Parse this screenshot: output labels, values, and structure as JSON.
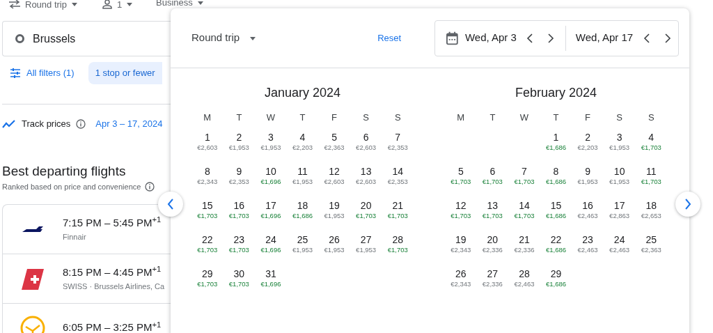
{
  "top_bar": {
    "trip_type": "Round trip",
    "passengers": "1",
    "cabin": "Business"
  },
  "origin": "Brussels",
  "filters": {
    "all_filters": "All filters (1)",
    "chip": "1 stop or fewer"
  },
  "track": {
    "label": "Track prices",
    "dates": "Apr 3 – 17, 2024"
  },
  "results": {
    "title": "Best departing flights",
    "subtitle": "Ranked based on price and convenience",
    "flights": [
      {
        "kind": "finnair",
        "times": "7:15 PM – 5:45 PM",
        "next_day": "+1",
        "airline": "Finnair"
      },
      {
        "kind": "swiss",
        "times": "8:15 PM – 4:45 PM",
        "next_day": "+1",
        "airline": "SWISS · Brussels Airlines, Ca"
      },
      {
        "kind": "lufthansa",
        "times": "6:05 PM – 3:25 PM",
        "next_day": "+1"
      }
    ]
  },
  "popup": {
    "trip_type": "Round trip",
    "reset": "Reset",
    "departure": "Wed, Apr 3",
    "return": "Wed, Apr 17",
    "months": [
      {
        "title": "January 2024",
        "weekdays": [
          "M",
          "T",
          "W",
          "T",
          "F",
          "S",
          "S"
        ],
        "weeks": [
          [
            {
              "day": "1",
              "price": "€2,603",
              "low": false
            },
            {
              "day": "2",
              "price": "€1,953",
              "low": false
            },
            {
              "day": "3",
              "price": "€1,953",
              "low": false
            },
            {
              "day": "4",
              "price": "€2,203",
              "low": false
            },
            {
              "day": "5",
              "price": "€2,363",
              "low": false
            },
            {
              "day": "6",
              "price": "€2,603",
              "low": false
            },
            {
              "day": "7",
              "price": "€2,353",
              "low": false
            }
          ],
          [
            {
              "day": "8",
              "price": "€2,343",
              "low": false
            },
            {
              "day": "9",
              "price": "€2,353",
              "low": false
            },
            {
              "day": "10",
              "price": "€1,696",
              "low": true
            },
            {
              "day": "11",
              "price": "€1,953",
              "low": false
            },
            {
              "day": "12",
              "price": "€2,603",
              "low": false
            },
            {
              "day": "13",
              "price": "€2,603",
              "low": false
            },
            {
              "day": "14",
              "price": "€2,353",
              "low": false
            }
          ],
          [
            {
              "day": "15",
              "price": "€1,703",
              "low": true
            },
            {
              "day": "16",
              "price": "€1,703",
              "low": true
            },
            {
              "day": "17",
              "price": "€1,696",
              "low": true
            },
            {
              "day": "18",
              "price": "€1,686",
              "low": true
            },
            {
              "day": "19",
              "price": "€1,953",
              "low": false
            },
            {
              "day": "20",
              "price": "€1,703",
              "low": true
            },
            {
              "day": "21",
              "price": "€1,703",
              "low": true
            }
          ],
          [
            {
              "day": "22",
              "price": "€1,703",
              "low": true
            },
            {
              "day": "23",
              "price": "€1,703",
              "low": true
            },
            {
              "day": "24",
              "price": "€1,696",
              "low": true
            },
            {
              "day": "25",
              "price": "€1,953",
              "low": false
            },
            {
              "day": "26",
              "price": "€1,953",
              "low": false
            },
            {
              "day": "27",
              "price": "€1,953",
              "low": false
            },
            {
              "day": "28",
              "price": "€1,703",
              "low": true
            }
          ],
          [
            {
              "day": "29",
              "price": "€1,703",
              "low": true
            },
            {
              "day": "30",
              "price": "€1,703",
              "low": true
            },
            {
              "day": "31",
              "price": "€1,696",
              "low": true
            }
          ]
        ]
      },
      {
        "title": "February 2024",
        "weekdays": [
          "M",
          "T",
          "W",
          "T",
          "F",
          "S",
          "S"
        ],
        "weeks": [
          [
            {
              "day": "1",
              "price": "€1,686",
              "low": true
            },
            {
              "day": "2",
              "price": "€2,203",
              "low": false
            },
            {
              "day": "3",
              "price": "€1,953",
              "low": false
            },
            {
              "day": "4",
              "price": "€1,703",
              "low": true
            }
          ],
          [
            {
              "day": "5",
              "price": "€1,703",
              "low": true
            },
            {
              "day": "6",
              "price": "€1,703",
              "low": true
            },
            {
              "day": "7",
              "price": "€1,703",
              "low": true
            },
            {
              "day": "8",
              "price": "€1,686",
              "low": true
            },
            {
              "day": "9",
              "price": "€1,953",
              "low": false
            },
            {
              "day": "10",
              "price": "€1,953",
              "low": false
            },
            {
              "day": "11",
              "price": "€1,703",
              "low": true
            }
          ],
          [
            {
              "day": "12",
              "price": "€1,703",
              "low": true
            },
            {
              "day": "13",
              "price": "€1,703",
              "low": true
            },
            {
              "day": "14",
              "price": "€1,703",
              "low": true
            },
            {
              "day": "15",
              "price": "€1,686",
              "low": true
            },
            {
              "day": "16",
              "price": "€2,463",
              "low": false
            },
            {
              "day": "17",
              "price": "€2,863",
              "low": false
            },
            {
              "day": "18",
              "price": "€2,653",
              "low": false
            }
          ],
          [
            {
              "day": "19",
              "price": "€2,343",
              "low": false
            },
            {
              "day": "20",
              "price": "€2,336",
              "low": false
            },
            {
              "day": "21",
              "price": "€2,336",
              "low": false
            },
            {
              "day": "22",
              "price": "€1,686",
              "low": true
            },
            {
              "day": "23",
              "price": "€2,463",
              "low": false
            },
            {
              "day": "24",
              "price": "€2,463",
              "low": false
            },
            {
              "day": "25",
              "price": "€2,363",
              "low": false
            }
          ],
          [
            {
              "day": "26",
              "price": "€2,343",
              "low": false
            },
            {
              "day": "27",
              "price": "€2,336",
              "low": false
            },
            {
              "day": "28",
              "price": "€2,463",
              "low": false
            },
            {
              "day": "29",
              "price": "€1,686",
              "low": true
            }
          ]
        ]
      }
    ]
  }
}
